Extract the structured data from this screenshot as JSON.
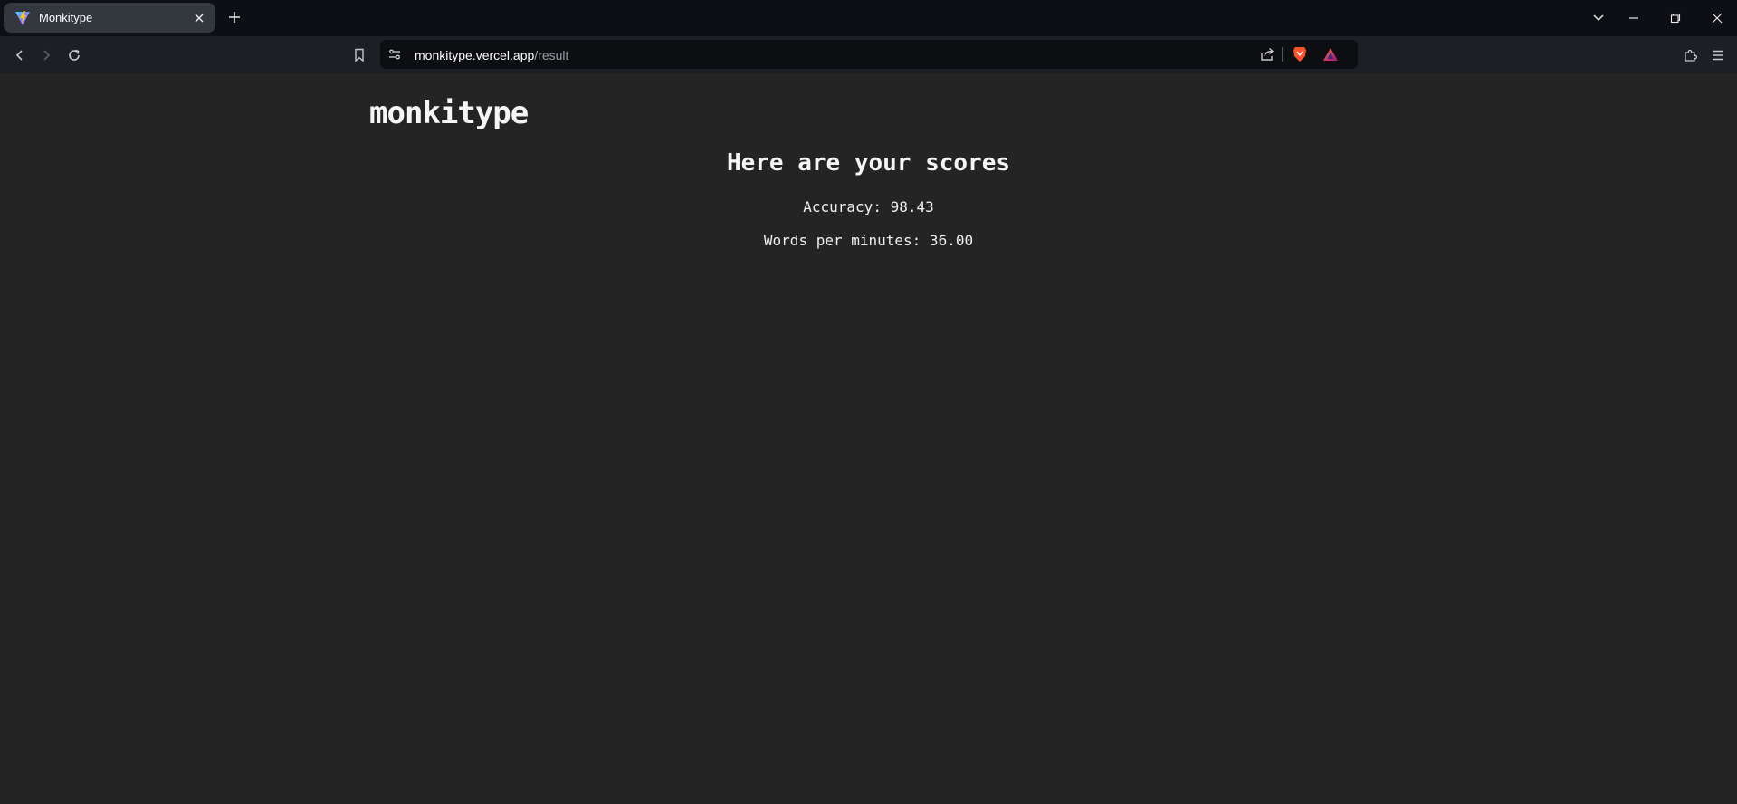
{
  "browser": {
    "tab": {
      "title": "Monkitype",
      "favicon": "vite-logo-icon",
      "close_icon": "close-icon"
    },
    "new_tab_icon": "plus-icon",
    "window_controls": [
      "tab-search-icon",
      "minimize-icon",
      "restore-icon",
      "close-icon"
    ],
    "toolbar": {
      "back_icon": "back-arrow-icon",
      "forward_icon": "forward-arrow-icon",
      "reload_icon": "reload-icon",
      "bookmark_icon": "bookmark-icon",
      "site_settings_icon": "site-settings-icon",
      "url_host": "monkitype.vercel.app",
      "url_path": "/result",
      "share_icon": "share-icon",
      "brave_shields_icon": "brave-shields-icon",
      "brave_rewards_icon": "brave-rewards-icon",
      "extensions_icon": "puzzle-icon",
      "menu_icon": "hamburger-menu-icon"
    }
  },
  "page": {
    "logo": "monkitype",
    "heading": "Here are your scores",
    "accuracy_text": "Accuracy: 98.43",
    "wpm_text": "Words per minutes: 36.00"
  },
  "colors": {
    "page_background": "#242424",
    "text": "#f5f5f5",
    "tabstrip_background": "#0d0f14",
    "toolbar_background": "#1c1f26",
    "active_tab": "#33383f",
    "brave_orange": "#fb542b"
  }
}
